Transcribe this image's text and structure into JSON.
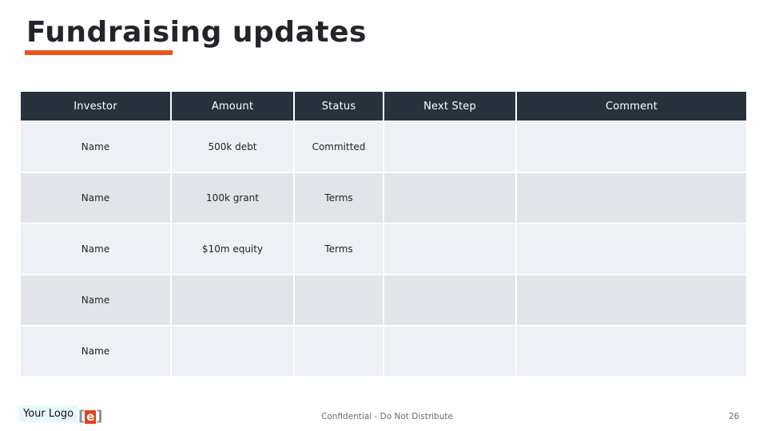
{
  "slide": {
    "title": "Fundraising updates",
    "accent_color": "#e8541c"
  },
  "table": {
    "columns": [
      "Investor",
      "Amount",
      "Status",
      "Next Step",
      "Comment"
    ],
    "rows": [
      {
        "investor": "Name",
        "amount": "500k debt",
        "status": "Committed",
        "next_step": "",
        "comment": ""
      },
      {
        "investor": "Name",
        "amount": "100k grant",
        "status": "Terms",
        "next_step": "",
        "comment": ""
      },
      {
        "investor": "Name",
        "amount": "$10m equity",
        "status": "Terms",
        "next_step": "",
        "comment": ""
      },
      {
        "investor": "Name",
        "amount": "",
        "status": "",
        "next_step": "",
        "comment": ""
      },
      {
        "investor": "Name",
        "amount": "",
        "status": "",
        "next_step": "",
        "comment": ""
      }
    ],
    "header_color": "#27323d"
  },
  "footer": {
    "logo_placeholder": "Your Logo",
    "brand_letter": "e",
    "brand_open": "[",
    "brand_close": "]",
    "confidential": "Confidential - Do Not Distribute",
    "page_number": "26"
  }
}
